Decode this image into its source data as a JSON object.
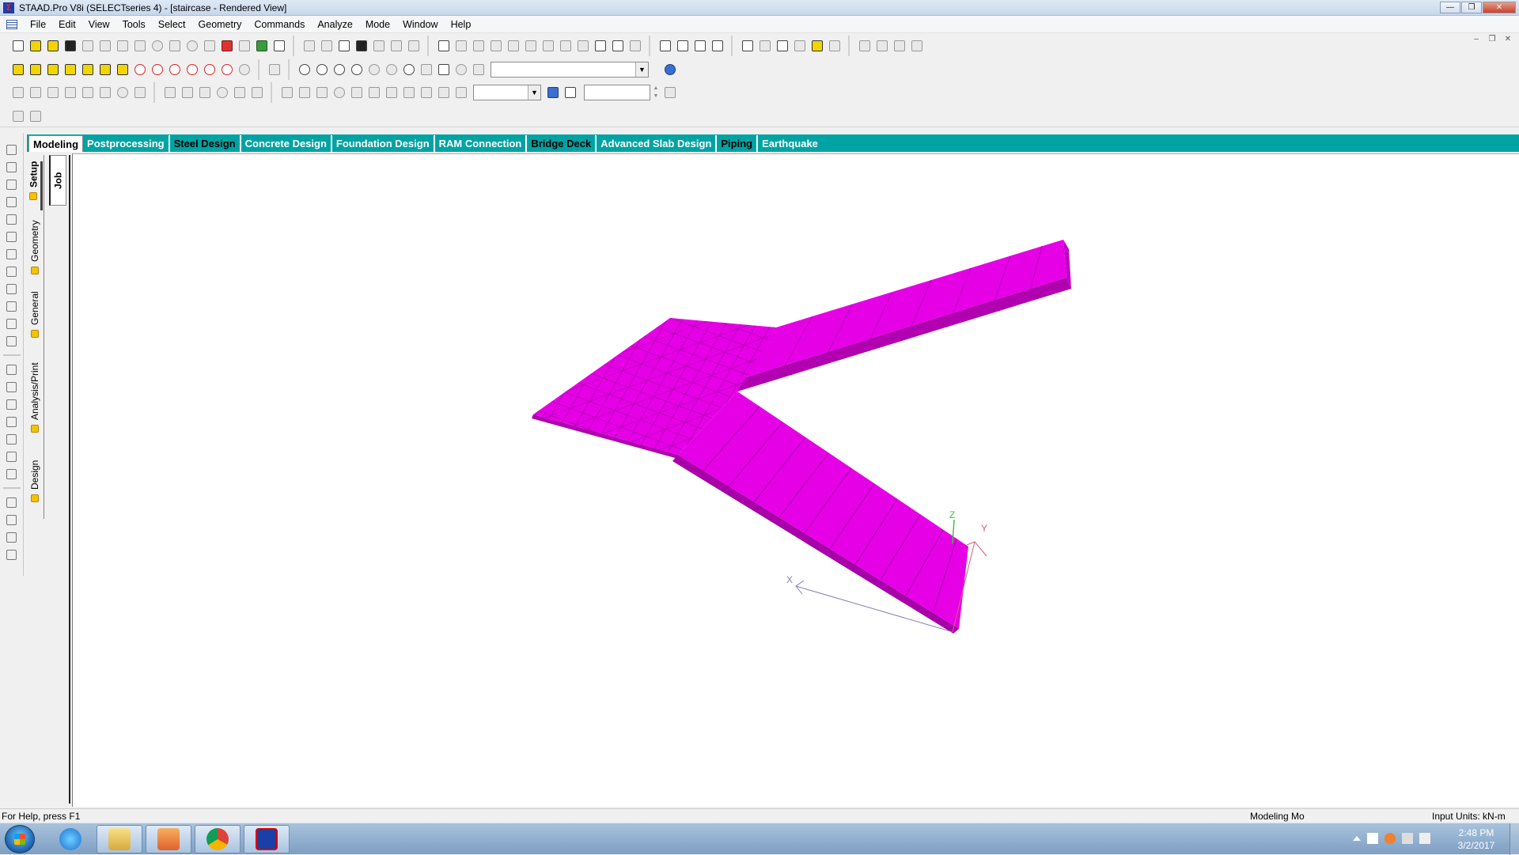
{
  "window": {
    "title": "STAAD.Pro V8i (SELECTseries 4) - [staircase - Rendered View]",
    "app_icon": "staad-logo-icon"
  },
  "menu": [
    "File",
    "Edit",
    "View",
    "Tools",
    "Select",
    "Geometry",
    "Commands",
    "Analyze",
    "Mode",
    "Window",
    "Help"
  ],
  "toolbar": {
    "view_combo_value": "",
    "small_combo_value": "",
    "spin_value": "",
    "help_icon": "help-question-icon"
  },
  "page_tabs": [
    {
      "label": "Modeling",
      "active": true
    },
    {
      "label": "Postprocessing",
      "active": false
    },
    {
      "label": "Steel Design",
      "active": false
    },
    {
      "label": "Concrete Design",
      "active": false
    },
    {
      "label": "Foundation Design",
      "active": false
    },
    {
      "label": "RAM Connection",
      "active": false
    },
    {
      "label": "Bridge Deck",
      "active": false
    },
    {
      "label": "Advanced Slab Design",
      "active": false
    },
    {
      "label": "Piping",
      "active": false
    },
    {
      "label": "Earthquake",
      "active": false
    }
  ],
  "side_tabs": {
    "setup": "Setup",
    "geometry": "Geometry",
    "general": "General",
    "analysis_print": "Analysis/Print",
    "design": "Design",
    "job": "Job"
  },
  "viewport": {
    "model_color": "#e600e6",
    "axis_labels": {
      "x": "X",
      "y": "Y",
      "z": "Z"
    }
  },
  "status": {
    "help": "For Help, press F1",
    "mode": "Modeling Mo",
    "units": "Input Units:  kN-m"
  },
  "taskbar": {
    "apps": [
      "internet-explorer-icon",
      "file-explorer-icon",
      "media-player-icon",
      "chrome-icon",
      "staad-pro-icon"
    ],
    "time": "2:48 PM",
    "date": "3/2/2017"
  }
}
